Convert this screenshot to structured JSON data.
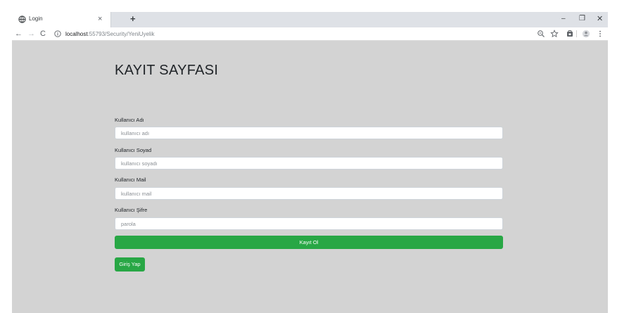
{
  "browser": {
    "tab": {
      "title": "Login",
      "close_glyph": "×",
      "favicon": "globe-icon"
    },
    "new_tab_glyph": "+",
    "window_controls": {
      "minimize": "–",
      "maximize": "❐",
      "close": "✕"
    },
    "toolbar": {
      "back_glyph": "←",
      "forward_glyph": "→",
      "reload_glyph": "C",
      "address_host": "localhost",
      "address_path": ":55793/Security/YeniUyelik",
      "icons": [
        "info-icon",
        "zoom-icon",
        "star-icon",
        "extension-icon",
        "profile-icon",
        "menu-icon"
      ]
    }
  },
  "page": {
    "title": "KAYIT SAYFASI",
    "background": "#d3d3d3",
    "accent": "#28a745",
    "form": {
      "fields": [
        {
          "label": "Kullanıcı Adı",
          "placeholder": "kullanıcı adı",
          "value": ""
        },
        {
          "label": "Kullanıcı Soyad",
          "placeholder": "kullanıcı soyadı",
          "value": ""
        },
        {
          "label": "Kullanıcı Mail",
          "placeholder": "kullanıcı mail",
          "value": ""
        },
        {
          "label": "Kullanıcı Şifre",
          "placeholder": "parola",
          "value": ""
        }
      ],
      "submit_label": "Kayıt Ol",
      "login_label": "Giriş Yap"
    }
  }
}
